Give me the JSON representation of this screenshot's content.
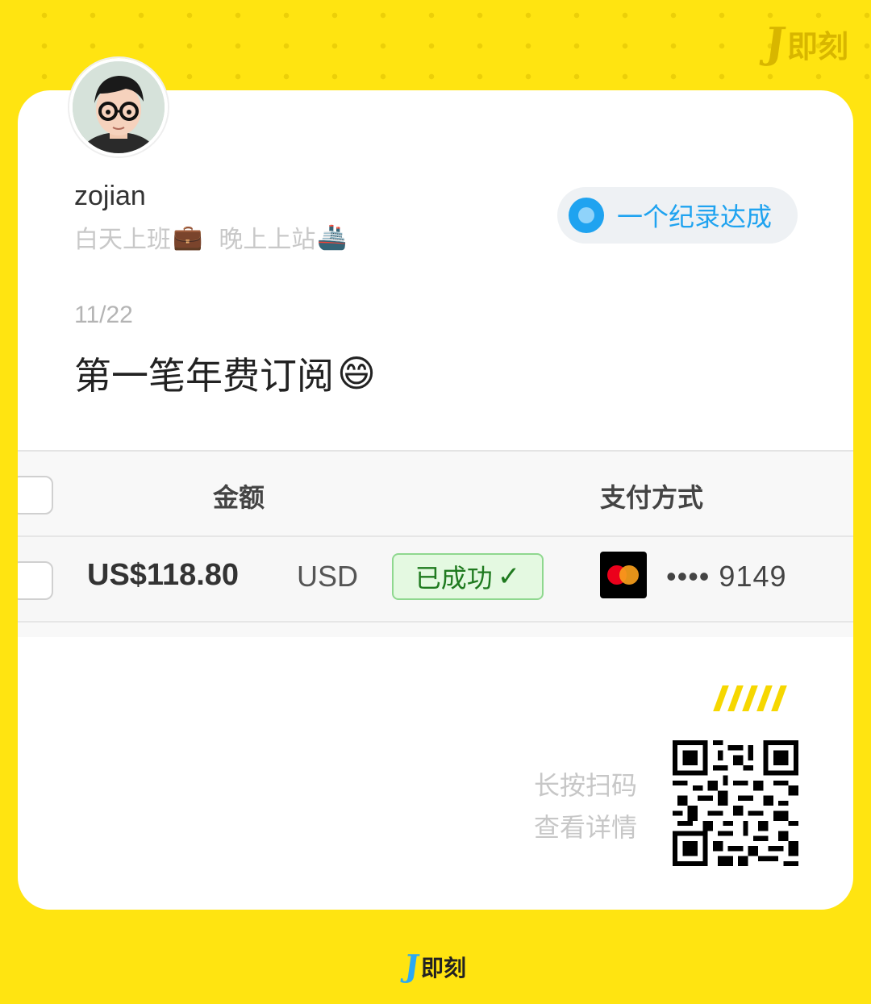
{
  "brand": {
    "logo_letter": "J",
    "name": "即刻"
  },
  "profile": {
    "username": "zojian",
    "bio_part1": "白天上班",
    "bio_emoji1": "💼",
    "bio_part2": "晚上上站",
    "bio_emoji2": "🚢"
  },
  "badge": {
    "label": "一个纪录达成",
    "color": "#1FA3F0"
  },
  "post": {
    "date": "11/22",
    "text": "第一笔年费订阅",
    "emoji": "😄"
  },
  "payment_table": {
    "columns": [
      "金额",
      "支付方式"
    ],
    "row": {
      "amount": "US$118.80",
      "currency": "USD",
      "status": "已成功",
      "status_icon": "✓",
      "card_brand": "mastercard-icon",
      "card_mask": "•••• 9149"
    }
  },
  "footer": {
    "scan_line1": "长按扫码",
    "scan_line2": "查看详情",
    "accent": "#F6D700"
  },
  "colors": {
    "background": "#FFE411",
    "card": "#FFFFFF"
  }
}
